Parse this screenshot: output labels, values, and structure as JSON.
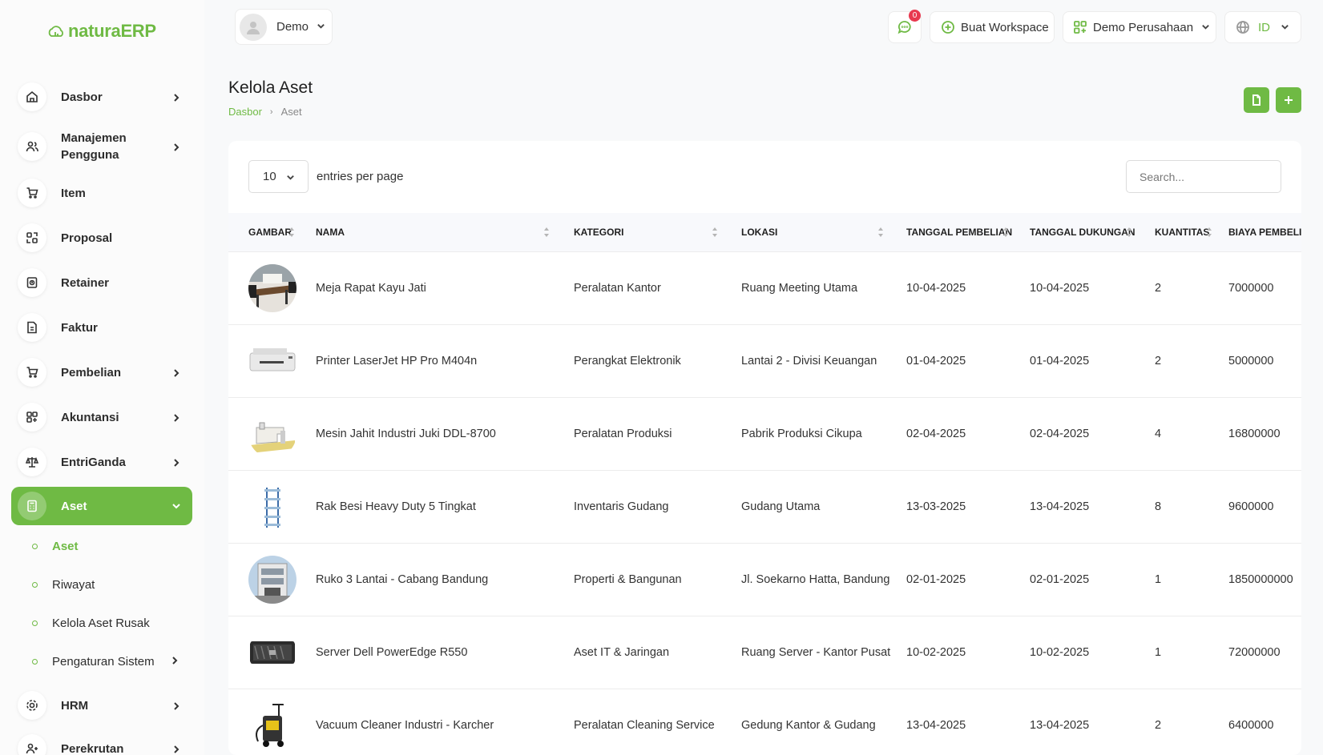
{
  "brand": {
    "part1": "natura",
    "part2": "ERP"
  },
  "sidebar": {
    "items": [
      {
        "label": "Dasbor",
        "icon": "home-icon"
      },
      {
        "label": "Manajemen Pengguna",
        "icon": "users-icon"
      },
      {
        "label": "Item",
        "icon": "cart-icon"
      },
      {
        "label": "Proposal",
        "icon": "proposal-icon"
      },
      {
        "label": "Retainer",
        "icon": "retainer-icon"
      },
      {
        "label": "Faktur",
        "icon": "invoice-icon"
      },
      {
        "label": "Pembelian",
        "icon": "cart-icon"
      },
      {
        "label": "Akuntansi",
        "icon": "grid-icon"
      },
      {
        "label": "EntriGanda",
        "icon": "scale-icon"
      },
      {
        "label": "Aset",
        "icon": "calculator-icon"
      },
      {
        "label": "HRM",
        "icon": "hrm-icon"
      },
      {
        "label": "Perekrutan",
        "icon": "user-add-icon"
      }
    ],
    "subitems": [
      {
        "label": "Aset"
      },
      {
        "label": "Riwayat"
      },
      {
        "label": "Kelola Aset Rusak"
      },
      {
        "label": "Pengaturan Sistem"
      }
    ]
  },
  "header": {
    "user": "Demo",
    "notification_count": "0",
    "create_workspace": "Buat Workspace",
    "company": "Demo Perusahaan",
    "language": "ID"
  },
  "page": {
    "title": "Kelola Aset",
    "breadcrumb_home": "Dasbor",
    "breadcrumb_current": "Aset"
  },
  "table": {
    "entries_value": "10",
    "entries_label": "entries per page",
    "search_placeholder": "Search...",
    "columns": [
      "GAMBAR",
      "NAMA",
      "KATEGORI",
      "LOKASI",
      "TANGGAL PEMBELIAN",
      "TANGGAL DUKUNGAN",
      "KUANTITAS",
      "BIAYA PEMBELIAN"
    ],
    "rows": [
      {
        "image": "meeting-table",
        "nama": "Meja Rapat Kayu Jati",
        "kategori": "Peralatan Kantor",
        "lokasi": "Ruang Meeting Utama",
        "tgl_beli": "10-04-2025",
        "tgl_dukungan": "10-04-2025",
        "qty": "2",
        "biaya": "7000000"
      },
      {
        "image": "printer",
        "nama": "Printer LaserJet HP Pro M404n",
        "kategori": "Perangkat Elektronik",
        "lokasi": "Lantai 2 - Divisi Keuangan",
        "tgl_beli": "01-04-2025",
        "tgl_dukungan": "01-04-2025",
        "qty": "2",
        "biaya": "5000000"
      },
      {
        "image": "sewing-machine",
        "nama": "Mesin Jahit Industri Juki DDL-8700",
        "kategori": "Peralatan Produksi",
        "lokasi": "Pabrik Produksi Cikupa",
        "tgl_beli": "02-04-2025",
        "tgl_dukungan": "02-04-2025",
        "qty": "4",
        "biaya": "16800000"
      },
      {
        "image": "shelf",
        "nama": "Rak Besi Heavy Duty 5 Tingkat",
        "kategori": "Inventaris Gudang",
        "lokasi": "Gudang Utama",
        "tgl_beli": "13-03-2025",
        "tgl_dukungan": "13-04-2025",
        "qty": "8",
        "biaya": "9600000"
      },
      {
        "image": "building",
        "nama": "Ruko 3 Lantai - Cabang Bandung",
        "kategori": "Properti & Bangunan",
        "lokasi": "Jl. Soekarno Hatta, Bandung",
        "tgl_beli": "02-01-2025",
        "tgl_dukungan": "02-01-2025",
        "qty": "1",
        "biaya": "1850000000"
      },
      {
        "image": "server",
        "nama": "Server Dell PowerEdge R550",
        "kategori": "Aset IT & Jaringan",
        "lokasi": "Ruang Server - Kantor Pusat",
        "tgl_beli": "10-02-2025",
        "tgl_dukungan": "10-02-2025",
        "qty": "1",
        "biaya": "72000000"
      },
      {
        "image": "vacuum",
        "nama": "Vacuum Cleaner Industri - Karcher",
        "kategori": "Peralatan Cleaning Service",
        "lokasi": "Gedung Kantor & Gudang",
        "tgl_beli": "13-04-2025",
        "tgl_dukungan": "13-04-2025",
        "qty": "2",
        "biaya": "6400000"
      }
    ]
  },
  "colors": {
    "accent": "#6fba44",
    "badge": "#e8384f"
  }
}
